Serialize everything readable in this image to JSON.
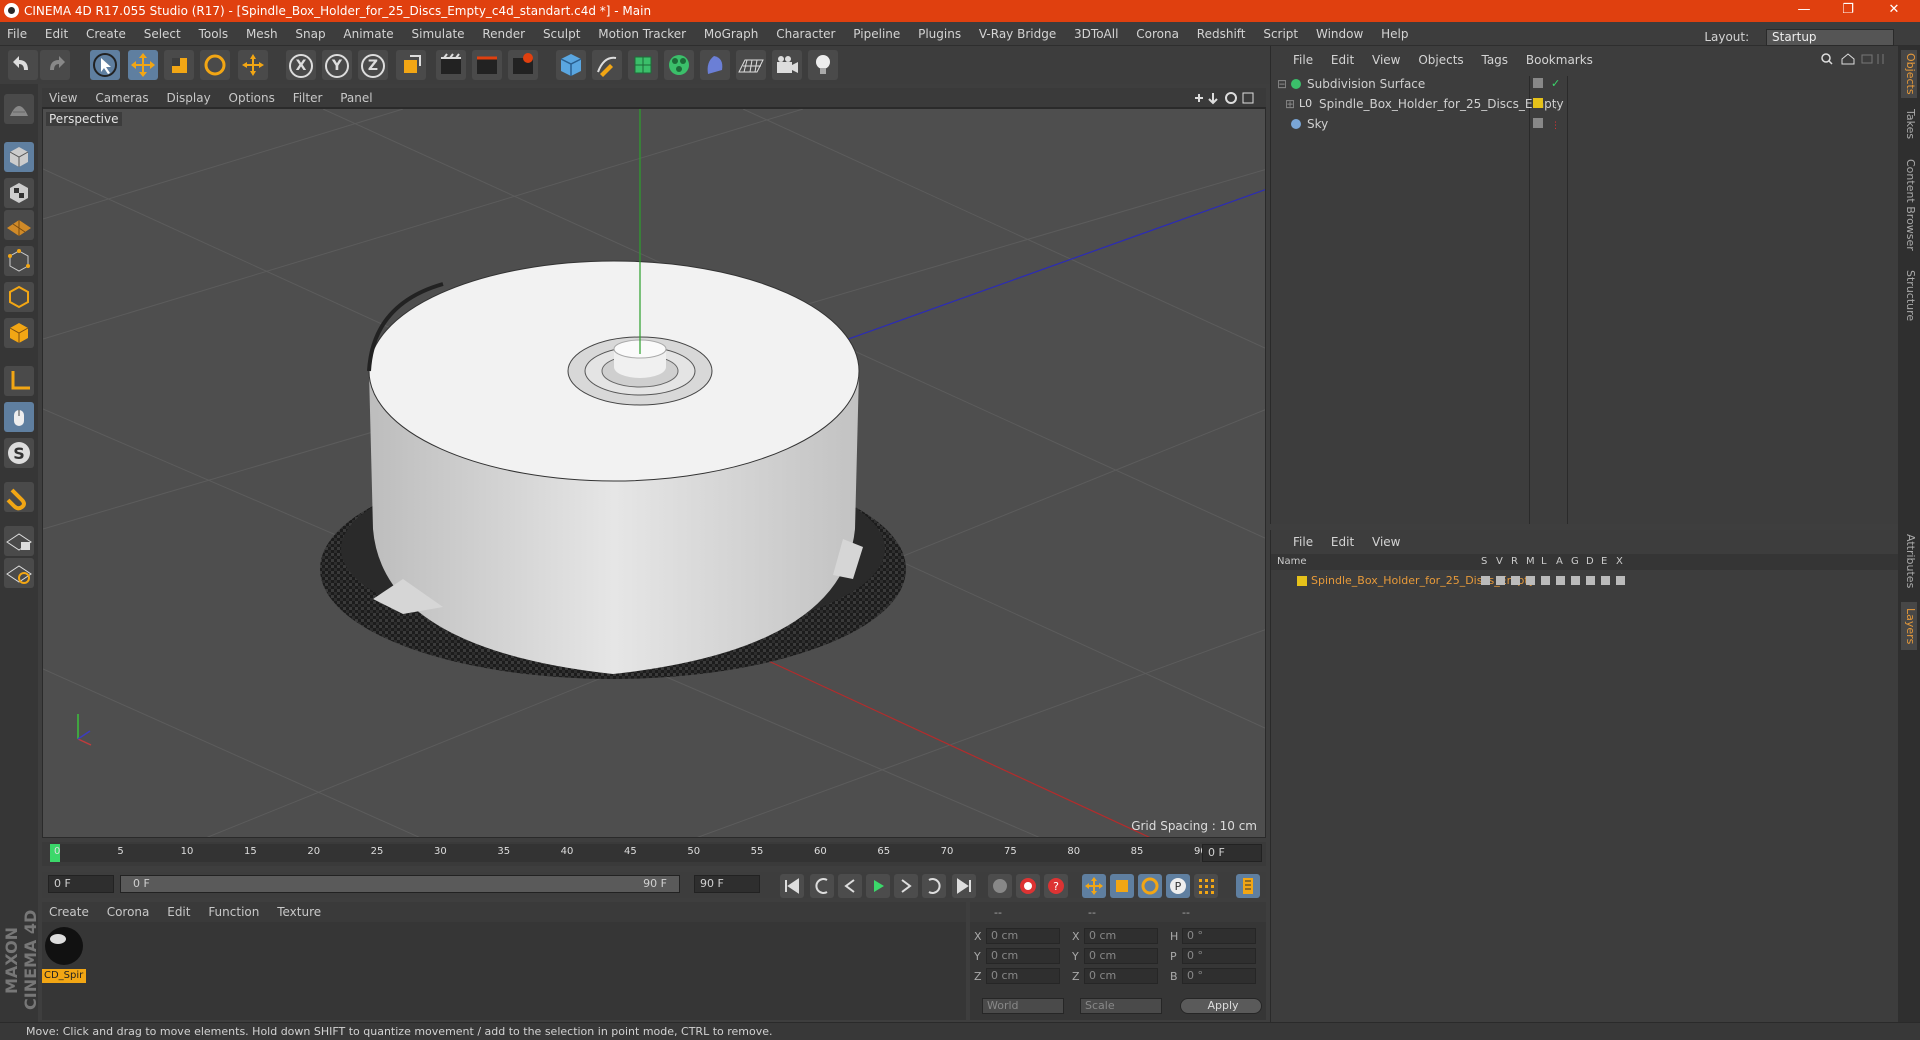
{
  "window": {
    "title": "CINEMA 4D R17.055 Studio (R17) - [Spindle_Box_Holder_for_25_Discs_Empty_c4d_standart.c4d *] - Main",
    "min_label": "—",
    "max_label": "❐",
    "close_label": "✕"
  },
  "menubar": {
    "items": [
      "File",
      "Edit",
      "Create",
      "Select",
      "Tools",
      "Mesh",
      "Snap",
      "Animate",
      "Simulate",
      "Render",
      "Sculpt",
      "Motion Tracker",
      "MoGraph",
      "Character",
      "Pipeline",
      "Plugins",
      "V-Ray Bridge",
      "3DToAll",
      "Corona",
      "Redshift",
      "Script",
      "Window",
      "Help"
    ],
    "layout_label": "Layout:",
    "layout_value": "Startup"
  },
  "toolbar": {
    "axis_x": "X",
    "axis_y": "Y",
    "axis_z": "Z"
  },
  "viewport": {
    "menu": [
      "View",
      "Cameras",
      "Display",
      "Options",
      "Filter",
      "Panel"
    ],
    "label": "Perspective",
    "grid_spacing": "Grid Spacing : 10 cm"
  },
  "timeline": {
    "ticks": [
      "0",
      "5",
      "10",
      "15",
      "20",
      "25",
      "30",
      "35",
      "40",
      "45",
      "50",
      "55",
      "60",
      "65",
      "70",
      "75",
      "80",
      "85",
      "90"
    ],
    "current_frame": "0 F",
    "start_field": "0 F",
    "range_start": "0 F",
    "range_end": "90 F",
    "end_field": "90 F"
  },
  "material_manager": {
    "menu": [
      "Create",
      "Corona",
      "Edit",
      "Function",
      "Texture"
    ],
    "material_name": "CD_Spir"
  },
  "coordinates": {
    "header": [
      "--",
      "--",
      "--"
    ],
    "rows": [
      {
        "l1": "X",
        "v1": "0 cm",
        "l2": "X",
        "v2": "0 cm",
        "l3": "H",
        "v3": "0 °"
      },
      {
        "l1": "Y",
        "v1": "0 cm",
        "l2": "Y",
        "v2": "0 cm",
        "l3": "P",
        "v3": "0 °"
      },
      {
        "l1": "Z",
        "v1": "0 cm",
        "l2": "Z",
        "v2": "0 cm",
        "l3": "B",
        "v3": "0 °"
      }
    ],
    "mode_world": "World",
    "mode_scale": "Scale",
    "apply_label": "Apply"
  },
  "object_manager": {
    "menu": [
      "File",
      "Edit",
      "View",
      "Objects",
      "Tags",
      "Bookmarks"
    ],
    "objects": [
      {
        "name": "Subdivision Surface"
      },
      {
        "name": "Spindle_Box_Holder_for_25_Discs_Empty"
      },
      {
        "name": "Sky"
      }
    ]
  },
  "layer_manager": {
    "menu": [
      "File",
      "Edit",
      "View"
    ],
    "col_name": "Name",
    "columns": [
      "S",
      "V",
      "R",
      "M",
      "L",
      "A",
      "G",
      "D",
      "E",
      "X"
    ],
    "layer_name": "Spindle_Box_Holder_for_25_Discs_Empty",
    "layer_color": "#e6c21a"
  },
  "side_tabs": [
    "Objects",
    "Takes",
    "Content Browser",
    "Structure",
    "Attributes",
    "Layers"
  ],
  "status": {
    "text": "Move: Click and drag to move elements. Hold down SHIFT to quantize movement / add to the selection in point mode, CTRL to remove."
  },
  "brand": {
    "logo_text": "MAXON CINEMA 4D"
  },
  "colors": {
    "accent": "#e0400f",
    "selection_blue": "#5f7fa0",
    "layer_text": "#e79a3a"
  }
}
